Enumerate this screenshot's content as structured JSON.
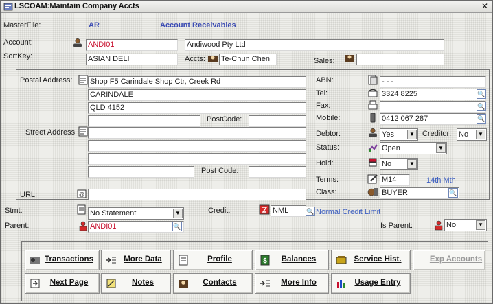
{
  "window": {
    "title": "LSCOAM:Maintain Company Accts",
    "close": "✕"
  },
  "header": {
    "masterfile_label": "MasterFile:",
    "masterfile_value": "AR",
    "masterfile_name": "Account Receivables"
  },
  "account": {
    "label": "Account:",
    "code": "ANDI01",
    "name": "Andiwood Pty Ltd"
  },
  "sortkey": {
    "label": "SortKey:",
    "value": "ASIAN DELI",
    "accts_label": "Accts:",
    "accts_value": "Te-Chun Chen",
    "sales_label": "Sales:",
    "sales_value": ""
  },
  "postal": {
    "label": "Postal Address:",
    "line1": "Shop F5 Carindale Shop Ctr, Creek Rd",
    "line2": "CARINDALE",
    "line3": "QLD  4152",
    "line4": "",
    "postcode_label": "PostCode:",
    "postcode": ""
  },
  "street": {
    "label": "Street Address",
    "line1": "",
    "line2": "",
    "line3": "",
    "line4": "",
    "postcode_label": "Post Code:",
    "postcode": ""
  },
  "url": {
    "label": "URL:",
    "value": ""
  },
  "contact": {
    "abn_label": "ABN:",
    "abn": "-   -   -",
    "tel_label": "Tel:",
    "tel": "3324 8225",
    "fax_label": "Fax:",
    "fax": "",
    "mobile_label": "Mobile:",
    "mobile": "0412 067 287"
  },
  "status": {
    "debtor_label": "Debtor:",
    "debtor": "Yes",
    "creditor_label": "Creditor:",
    "creditor": "No",
    "status_label": "Status:",
    "status": "Open",
    "hold_label": "Hold:",
    "hold": "No",
    "terms_label": "Terms:",
    "terms": "M14",
    "terms_desc": "14th Mth",
    "class_label": "Class:",
    "class": "BUYER"
  },
  "statement": {
    "label": "Stmt:",
    "value": "No Statement",
    "credit_label": "Credit:",
    "credit": "NML",
    "credit_desc": "Normal Credit Limit"
  },
  "parent": {
    "label": "Parent:",
    "value": "ANDI01",
    "is_parent_label": "Is Parent:",
    "is_parent": "No"
  },
  "buttons": {
    "transactions": "Transactions",
    "more_data": "More Data",
    "profile": "Profile",
    "balances": "Balances",
    "service_hist": "Service Hist.",
    "exp_accounts": "Exp Accounts",
    "next_page": "Next Page",
    "notes": "Notes",
    "contacts": "Contacts",
    "more_info": "More Info",
    "usage_entry": "Usage Entry"
  },
  "glyphs": {
    "dropdown": "▼",
    "lookup": "🔍"
  }
}
